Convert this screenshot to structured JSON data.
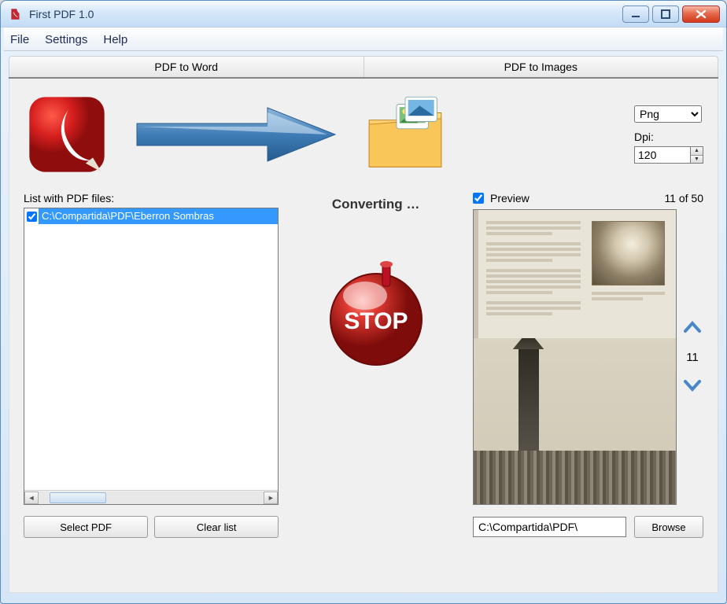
{
  "window": {
    "title": "First PDF 1.0"
  },
  "menu": {
    "file": "File",
    "settings": "Settings",
    "help": "Help"
  },
  "tabs": {
    "word": "PDF to Word",
    "images": "PDF to Images"
  },
  "format": {
    "selected": "Png",
    "dpi_label": "Dpi:",
    "dpi_value": "120"
  },
  "list": {
    "label": "List with PDF files:",
    "item_checked": true,
    "item_path": "C:\\Compartida\\PDF\\Eberron Sombras",
    "select_btn": "Select PDF",
    "clear_btn": "Clear list"
  },
  "status": {
    "converting": "Converting …",
    "stop": "STOP"
  },
  "preview": {
    "label": "Preview",
    "checked": true,
    "counter": "11 of 50",
    "current_page": "11",
    "output_path": "C:\\Compartida\\PDF\\",
    "browse": "Browse"
  }
}
